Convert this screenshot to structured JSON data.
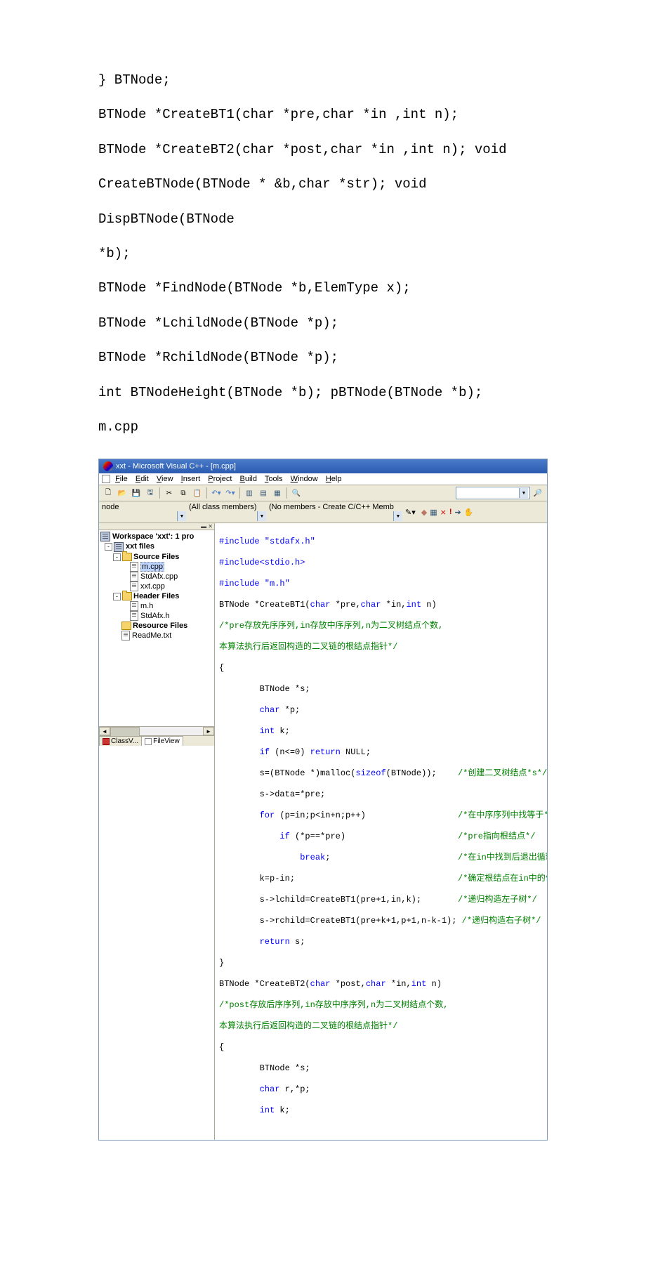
{
  "doc_lines": [
    "} BTNode;",
    "BTNode *CreateBT1(char *pre,char *in ,int n);",
    "BTNode *CreateBT2(char *post,char *in ,int n); void",
    "CreateBTNode(BTNode * &b,char *str); void DispBTNode(BTNode",
    "*b);",
    "BTNode *FindNode(BTNode *b,ElemType x);",
    "BTNode *LchildNode(BTNode *p);",
    "BTNode *RchildNode(BTNode *p);",
    "int BTNodeHeight(BTNode *b); pBTNode(BTNode *b);",
    "m.cpp"
  ],
  "ide": {
    "title": "xxt - Microsoft Visual C++ - [m.cpp]",
    "menu": [
      "File",
      "Edit",
      "View",
      "Insert",
      "Project",
      "Build",
      "Tools",
      "Window",
      "Help"
    ],
    "dd_text": "node",
    "dd_all": "(All class members)",
    "dd_no": "(No members - Create C/C++ Memb",
    "workspace": {
      "root": "Workspace 'xxt': 1 pro",
      "project": "xxt files",
      "source": "Source Files",
      "sfiles": [
        "m.cpp",
        "StdAfx.cpp",
        "xxt.cpp"
      ],
      "header": "Header Files",
      "hfiles": [
        "m.h",
        "StdAfx.h"
      ],
      "resource": "Resource Files",
      "readme": "ReadMe.txt",
      "tab_class": "ClassV...",
      "tab_file": "FileView"
    },
    "code": {
      "inc1": "#include \"stdafx.h\"",
      "inc2": "#include<stdio.h>",
      "inc3": "#include \"m.h\"",
      "fn1_sig_a": "BTNode *CreateBT1(",
      "fn1_sig_b": "char",
      "fn1_sig_c": " *pre,",
      "fn1_sig_d": "char",
      "fn1_sig_e": " *in,",
      "fn1_sig_f": "int",
      "fn1_sig_g": " n)",
      "cmt1": "/*pre存放先序序列,in存放中序序列,n为二叉树结点个数,",
      "cmt2": "本算法执行后返回构造的二叉链的根结点指针*/",
      "l_brace": "{",
      "v1": "        BTNode *s;",
      "v2a": "        ",
      "v2b": "char",
      "v2c": " *p;",
      "v3a": "        ",
      "v3b": "int",
      "v3c": " k;",
      "if1a": "        ",
      "if1b": "if",
      "if1c": " (n<=0) ",
      "if1d": "return",
      "if1e": " NULL;",
      "s1a": "        s=(BTNode *)malloc(",
      "s1b": "sizeof",
      "s1c": "(BTNode));",
      "c3": "/*创建二叉树结点*s*/",
      "s2": "        s->data=*pre;",
      "for1a": "        ",
      "for1b": "for",
      "for1c": " (p=in;p<in+n;p++)",
      "c4": "/*在中序序列中找等于*ppos的位置k",
      "ifp_a": "            ",
      "ifp_b": "if",
      "ifp_c": " (*p==*pre)",
      "c5": "/*pre指向根结点*/",
      "brk_a": "                ",
      "brk_b": "break",
      "brk_c": ";",
      "c6": "/*在in中找到后退出循环*/",
      "kpi": "        k=p-in;",
      "c7": "/*确定根结点在in中的位置*/",
      "lch": "        s->lchild=CreateBT1(pre+1,in,k);",
      "c8": "/*递归构造左子树*/",
      "rch": "        s->rchild=CreateBT1(pre+k+1,p+1,n-k-1);",
      "c9": " /*递归构造右子树*/",
      "ret_a": "        ",
      "ret_b": "return",
      "ret_c": " s;",
      "r_brace": "}",
      "fn2_a": "BTNode *CreateBT2(",
      "fn2_b": "char",
      "fn2_c": " *post,",
      "fn2_d": "char",
      "fn2_e": " *in,",
      "fn2_f": "int",
      "fn2_g": " n)",
      "cmt10": "/*post存放后序序列,in存放中序序列,n为二叉树结点个数,",
      "cmt11": "本算法执行后返回构造的二叉链的根结点指针*/",
      "v4": "        BTNode *s;",
      "v5a": "        ",
      "v5b": "char",
      "v5c": " r,*p;",
      "v6a": "        ",
      "v6b": "int",
      "v6c": " k;"
    }
  }
}
